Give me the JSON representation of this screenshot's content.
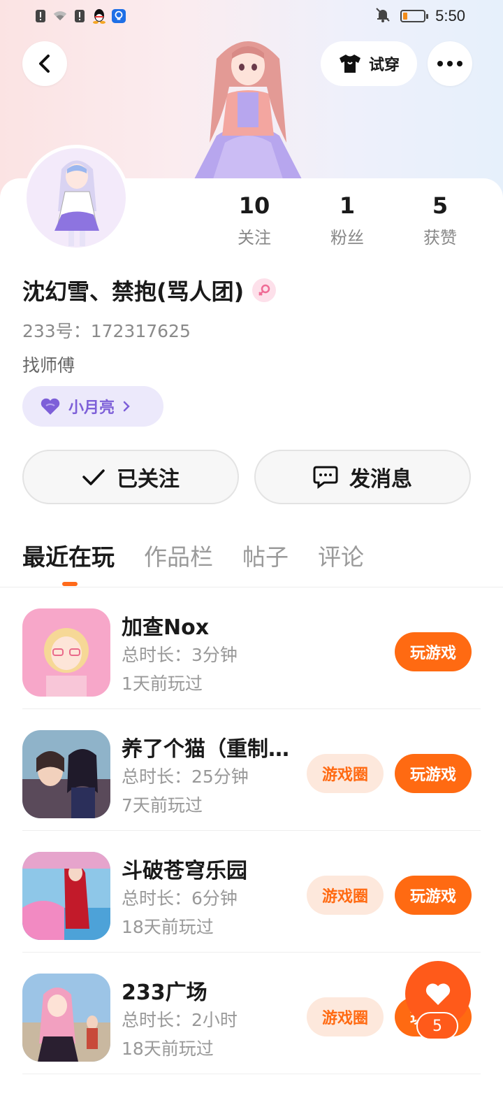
{
  "status_bar": {
    "time": "5:50",
    "left_icons": [
      "alert-icon",
      "wifi-icon",
      "sim-alert-icon",
      "qq-icon",
      "bulb-app-icon"
    ],
    "right_icons": [
      "bell-muted-icon",
      "battery-icon"
    ],
    "battery_level": 0.2
  },
  "header": {
    "tryon_label": "试穿"
  },
  "profile": {
    "name": "沈幻雪、禁抱(骂人团)",
    "uid": "233号：172317625",
    "bio": "找师傅",
    "tag_label": "小月亮",
    "stats": [
      {
        "num": "10",
        "label": "关注"
      },
      {
        "num": "1",
        "label": "粉丝"
      },
      {
        "num": "5",
        "label": "获赞"
      }
    ]
  },
  "actions": {
    "follow_label": "已关注",
    "message_label": "发消息"
  },
  "tabs": [
    "最近在玩",
    "作品栏",
    "帖子",
    "评论"
  ],
  "games": [
    {
      "title": "加查Nox",
      "duration": "总时长：3分钟",
      "last": "1天前玩过",
      "play": "玩游戏",
      "circle": ""
    },
    {
      "title": "养了个猫（重制…",
      "duration": "总时长：25分钟",
      "last": "7天前玩过",
      "play": "玩游戏",
      "circle": "游戏圈"
    },
    {
      "title": "斗破苍穹乐园",
      "duration": "总时长：6分钟",
      "last": "18天前玩过",
      "play": "玩游戏",
      "circle": "游戏圈"
    },
    {
      "title": "233广场",
      "duration": "总时长：2小时",
      "last": "18天前玩过",
      "play": "玩游戏",
      "circle": "游戏圈"
    }
  ],
  "fab": {
    "count": "5"
  },
  "colors": {
    "accent": "#ff6a12",
    "tag": "#7d5fd8"
  }
}
